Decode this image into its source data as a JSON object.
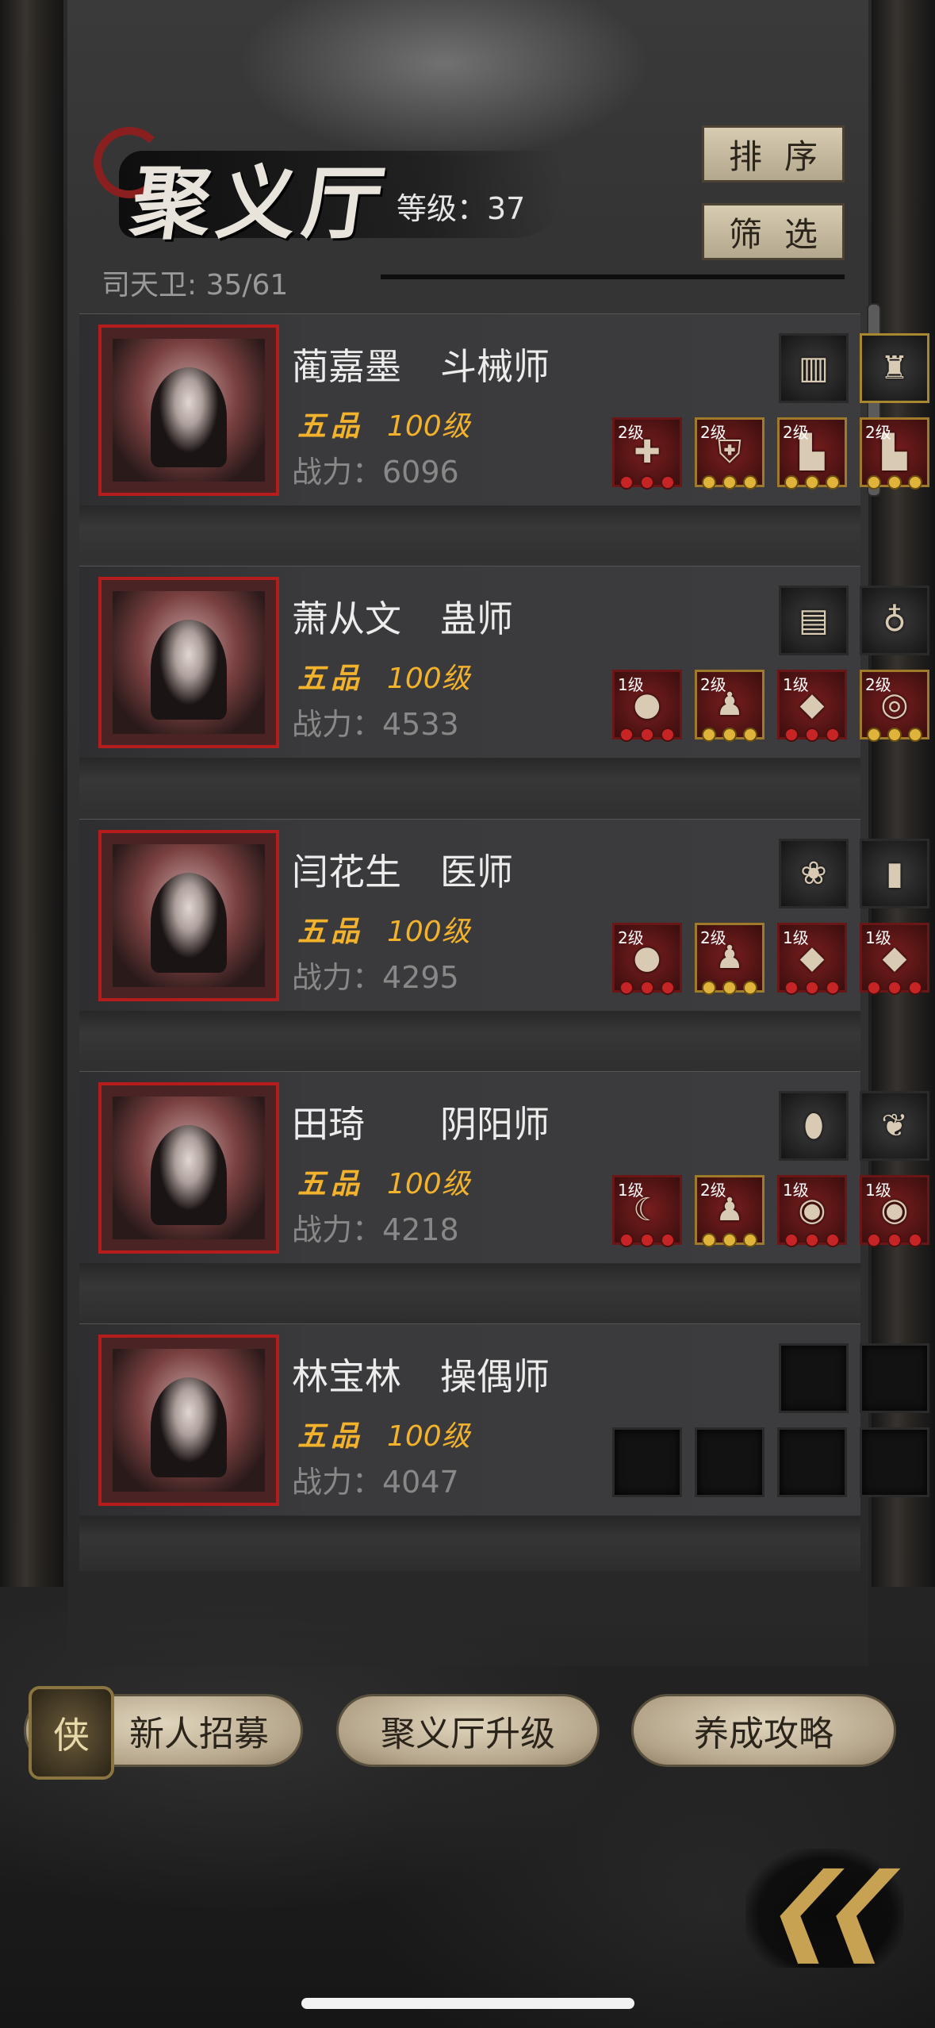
{
  "header": {
    "title": "聚义厅",
    "level_text": "等级：37",
    "guard_count": "司天卫: 35/61",
    "sort_label": "排序",
    "filter_label": "筛选"
  },
  "heroes": [
    {
      "name": "蔺嘉墨",
      "class": "斗械师",
      "rank": "五品",
      "level": "100级",
      "power": "战力：6096",
      "treasures": [
        "comb-icon",
        "lion-statue-icon"
      ],
      "equipment": [
        {
          "level": "2级",
          "icon": "crossbow-icon"
        },
        {
          "level": "2级",
          "icon": "armor-icon"
        },
        {
          "level": "2级",
          "icon": "boots-icon"
        },
        {
          "level": "2级",
          "icon": "boots-icon"
        }
      ]
    },
    {
      "name": "萧从文",
      "class": "蛊师",
      "rank": "五品",
      "level": "100级",
      "power": "战力：4533",
      "treasures": [
        "chest-icon",
        "pouch-icon"
      ],
      "equipment": [
        {
          "level": "1级",
          "icon": "gourd-icon"
        },
        {
          "level": "2级",
          "icon": "robe-icon"
        },
        {
          "level": "1级",
          "icon": "red-item-icon"
        },
        {
          "level": "2级",
          "icon": "bracelet-icon"
        }
      ]
    },
    {
      "name": "闫花生",
      "class": "医师",
      "rank": "五品",
      "level": "100级",
      "power": "战力：4295",
      "treasures": [
        "fan-icon",
        "token-icon"
      ],
      "equipment": [
        {
          "level": "2级",
          "icon": "gourd-icon"
        },
        {
          "level": "2级",
          "icon": "robe-icon"
        },
        {
          "level": "1级",
          "icon": "red-item-icon"
        },
        {
          "level": "1级",
          "icon": "red-item-icon"
        }
      ]
    },
    {
      "name": "田琦",
      "class": "阴阳师",
      "rank": "五品",
      "level": "100级",
      "power": "战力：4218",
      "treasures": [
        "amber-gem-icon",
        "feather-icon"
      ],
      "equipment": [
        {
          "level": "1级",
          "icon": "scythe-icon"
        },
        {
          "level": "2级",
          "icon": "robe-icon"
        },
        {
          "level": "1级",
          "icon": "jade-pendant-icon"
        },
        {
          "level": "1级",
          "icon": "jade-pendant-icon"
        }
      ]
    },
    {
      "name": "林宝林",
      "class": "操偶师",
      "rank": "五品",
      "level": "100级",
      "power": "战力：4047",
      "treasures": [
        "empty-slot",
        "empty-slot"
      ],
      "equipment": [
        {
          "level": "",
          "icon": "empty-slot"
        },
        {
          "level": "",
          "icon": "empty-slot"
        },
        {
          "level": "",
          "icon": "empty-slot"
        },
        {
          "level": "",
          "icon": "empty-slot"
        }
      ]
    }
  ],
  "footer": {
    "recruit_emblem": "侠",
    "recruit_label": "新人招募",
    "upgrade_label": "聚义厅升级",
    "guide_label": "养成攻略"
  }
}
